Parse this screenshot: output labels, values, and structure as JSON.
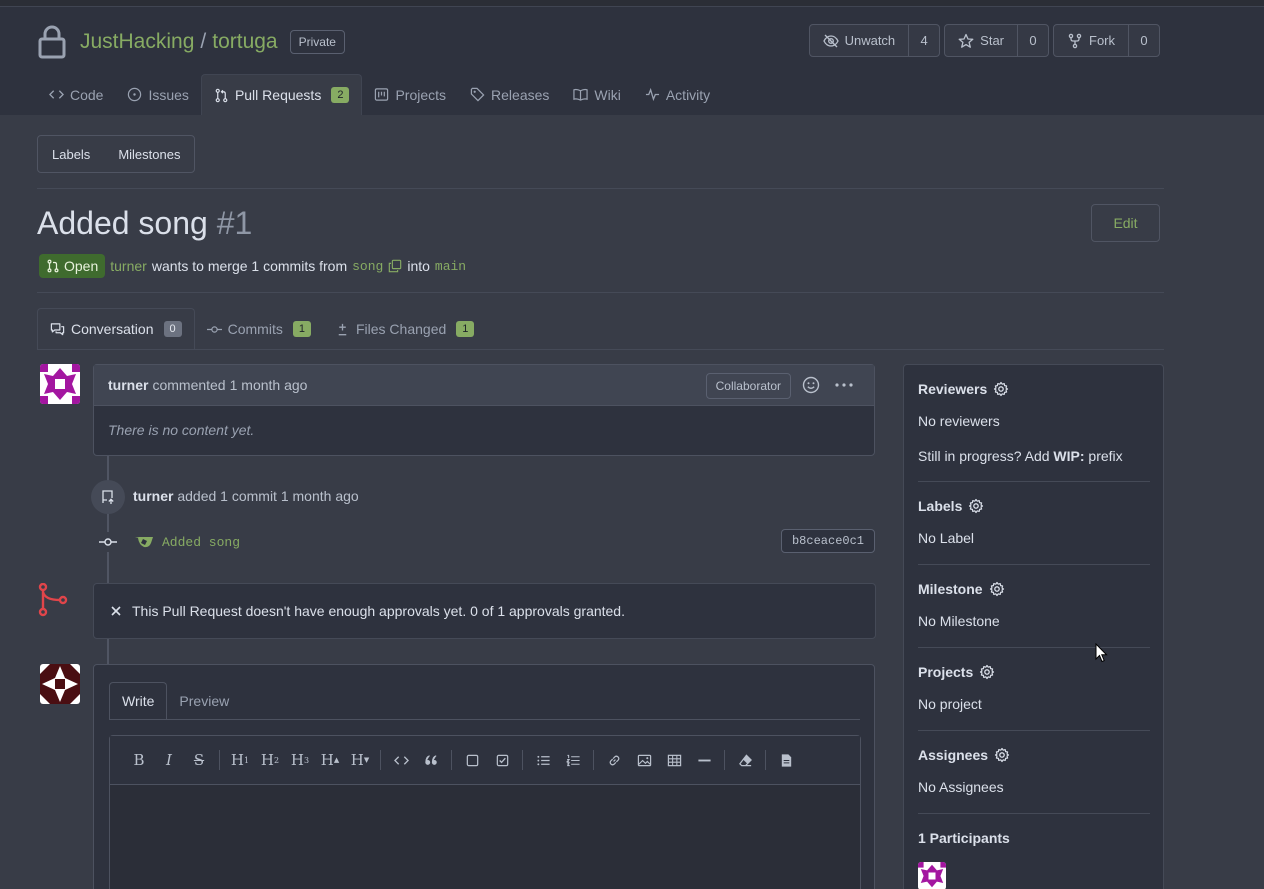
{
  "repo": {
    "owner": "JustHacking",
    "separator": "/",
    "name": "tortuga",
    "visibility": "Private"
  },
  "repo_buttons": {
    "watch": {
      "label": "Unwatch",
      "count": "4"
    },
    "star": {
      "label": "Star",
      "count": "0"
    },
    "fork": {
      "label": "Fork",
      "count": "0"
    }
  },
  "repo_tabs": [
    {
      "label": "Code",
      "icon": "code-icon"
    },
    {
      "label": "Issues",
      "icon": "issue-opened-icon"
    },
    {
      "label": "Pull Requests",
      "icon": "git-pull-request-icon",
      "count": "2"
    },
    {
      "label": "Projects",
      "icon": "project-icon"
    },
    {
      "label": "Releases",
      "icon": "tag-icon"
    },
    {
      "label": "Wiki",
      "icon": "book-icon"
    },
    {
      "label": "Activity",
      "icon": "pulse-icon"
    }
  ],
  "lm_bar": {
    "labels": "Labels",
    "milestones": "Milestones"
  },
  "pr": {
    "title": "Added song",
    "index": "#1",
    "edit_label": "Edit",
    "state": "Open",
    "user": "turner",
    "merge_text_1": "wants to merge 1 commits from",
    "head_branch": "song",
    "merge_text_2": "into",
    "base_branch": "main"
  },
  "pr_tabs": {
    "conversation": {
      "label": "Conversation",
      "count": "0"
    },
    "commits": {
      "label": "Commits",
      "count": "1"
    },
    "files": {
      "label": "Files Changed",
      "count": "1"
    }
  },
  "comment": {
    "author": "turner",
    "action": "commented",
    "time": "1 month ago",
    "role": "Collaborator",
    "body": "There is no content yet."
  },
  "event": {
    "author": "turner",
    "text": "added 1 commit 1 month ago"
  },
  "commit": {
    "message": "Added song",
    "sha": "b8ceace0c1"
  },
  "approval": {
    "text": "This Pull Request doesn't have enough approvals yet. 0 of 1 approvals granted."
  },
  "write": {
    "write_tab": "Write",
    "preview_tab": "Preview"
  },
  "sidebar": {
    "reviewers": {
      "title": "Reviewers",
      "value": "No reviewers"
    },
    "wip": {
      "prefix": "Still in progress? Add",
      "bold": "WIP:",
      "suffix": "prefix"
    },
    "labels": {
      "title": "Labels",
      "value": "No Label"
    },
    "milestone": {
      "title": "Milestone",
      "value": "No Milestone"
    },
    "projects": {
      "title": "Projects",
      "value": "No project"
    },
    "assignees": {
      "title": "Assignees",
      "value": "No Assignees"
    },
    "participants": {
      "title": "1 Participants"
    }
  },
  "colors": {
    "accent_green": "#87ab63",
    "open_badge": "#3f6b2e",
    "danger_red": "#e0454a",
    "background": "#383c47",
    "header_bg": "#2e323e"
  }
}
